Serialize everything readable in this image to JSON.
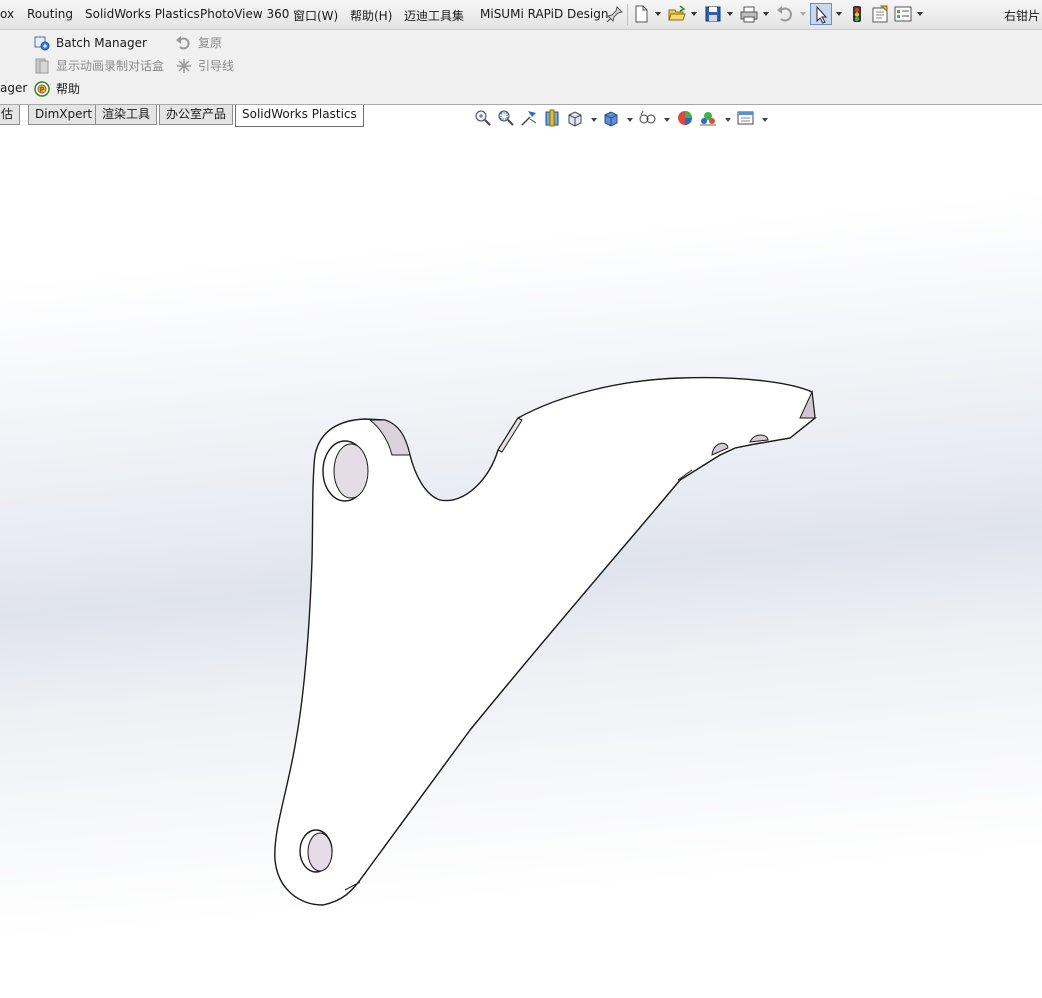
{
  "menu": {
    "items": [
      "ox",
      "Routing",
      "SolidWorks Plastics",
      "PhotoView 360",
      "窗口(W)",
      "帮助(H)",
      "迈迪工具集",
      "MiSUMi RAPiD Design"
    ],
    "right_text": "右钳片"
  },
  "command_manager": {
    "batch_manager": "Batch Manager",
    "restore": "复原",
    "animation_dialog": "显示动画录制对话盒",
    "leader_line": "引导线",
    "manager_partial": "ager",
    "help": "帮助"
  },
  "tabs": [
    {
      "label": "估",
      "active": false
    },
    {
      "label": "DimXpert",
      "active": false
    },
    {
      "label": "渲染工具",
      "active": false
    },
    {
      "label": "办公室产品",
      "active": false
    },
    {
      "label": "SolidWorks Plastics",
      "active": true
    }
  ],
  "colors": {
    "part_face": "#ffffff",
    "part_side": "#9c8e9e",
    "part_edge": "#1b1b1b",
    "accent_blue": "#1f5fb5"
  }
}
